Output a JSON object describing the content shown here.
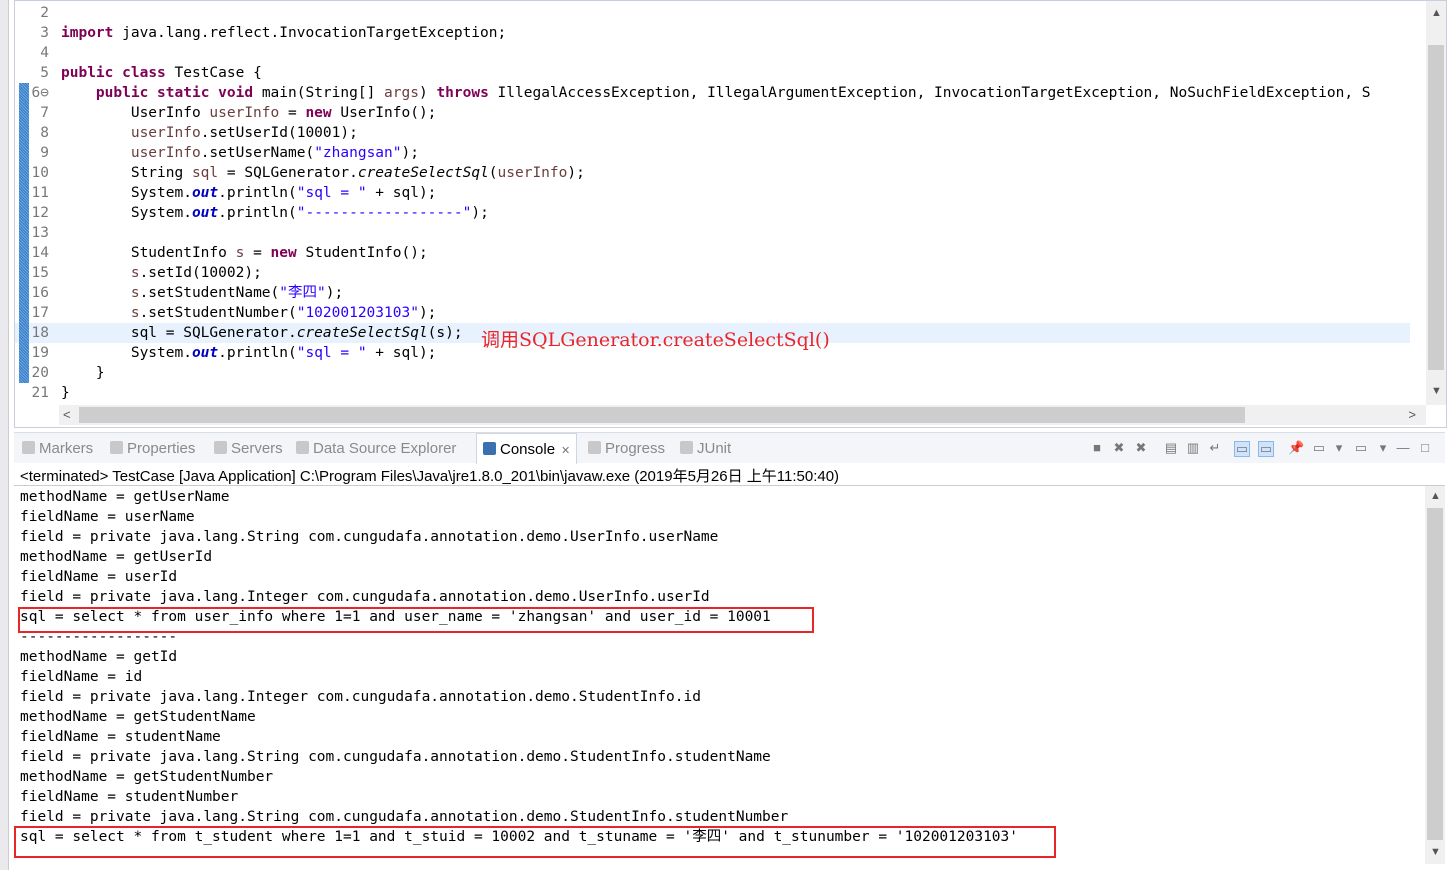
{
  "editor": {
    "lines": [
      {
        "n": "2",
        "t": []
      },
      {
        "n": "3",
        "t": [
          [
            "import",
            "k"
          ],
          [
            " java.lang.reflect.InvocationTargetException;",
            ""
          ]
        ]
      },
      {
        "n": "4",
        "t": []
      },
      {
        "n": "5",
        "t": [
          [
            "public",
            "k"
          ],
          [
            " ",
            ""
          ],
          [
            "class",
            "k"
          ],
          [
            " TestCase {",
            ""
          ]
        ]
      },
      {
        "n": "6⊖",
        "t": [
          [
            "    ",
            ""
          ],
          [
            "public",
            "k"
          ],
          [
            " ",
            ""
          ],
          [
            "static",
            "k"
          ],
          [
            " ",
            ""
          ],
          [
            "void",
            "k"
          ],
          [
            " main(String[] ",
            ""
          ],
          [
            "args",
            "p"
          ],
          [
            ") ",
            ""
          ],
          [
            "throws",
            "k"
          ],
          [
            " IllegalAccessException, IllegalArgumentException, InvocationTargetException, NoSuchFieldException, S",
            ""
          ]
        ]
      },
      {
        "n": "7",
        "t": [
          [
            "        UserInfo ",
            ""
          ],
          [
            "userInfo",
            "v"
          ],
          [
            " = ",
            ""
          ],
          [
            "new",
            "k"
          ],
          [
            " UserInfo();",
            ""
          ]
        ]
      },
      {
        "n": "8",
        "t": [
          [
            "        ",
            ""
          ],
          [
            "userInfo",
            "v"
          ],
          [
            ".setUserId(10001);",
            ""
          ]
        ]
      },
      {
        "n": "9",
        "t": [
          [
            "        ",
            ""
          ],
          [
            "userInfo",
            "v"
          ],
          [
            ".setUserName(",
            ""
          ],
          [
            "\"zhangsan\"",
            "s"
          ],
          [
            ");",
            ""
          ]
        ]
      },
      {
        "n": "10",
        "t": [
          [
            "        String ",
            ""
          ],
          [
            "sql",
            "v"
          ],
          [
            " = SQLGenerator.",
            ""
          ],
          [
            "createSelectSql",
            "i"
          ],
          [
            "(",
            ""
          ],
          [
            "userInfo",
            "v"
          ],
          [
            ");",
            ""
          ]
        ]
      },
      {
        "n": "11",
        "t": [
          [
            "        System.",
            ""
          ],
          [
            "out",
            "sf"
          ],
          [
            ".println(",
            ""
          ],
          [
            "\"sql = \"",
            "s"
          ],
          [
            " + sql);",
            ""
          ]
        ]
      },
      {
        "n": "12",
        "t": [
          [
            "        System.",
            ""
          ],
          [
            "out",
            "sf"
          ],
          [
            ".println(",
            ""
          ],
          [
            "\"------------------\"",
            "s"
          ],
          [
            ");",
            ""
          ]
        ]
      },
      {
        "n": "13",
        "t": []
      },
      {
        "n": "14",
        "t": [
          [
            "        StudentInfo ",
            ""
          ],
          [
            "s",
            "v"
          ],
          [
            " = ",
            ""
          ],
          [
            "new",
            "k"
          ],
          [
            " StudentInfo();",
            ""
          ]
        ]
      },
      {
        "n": "15",
        "t": [
          [
            "        ",
            ""
          ],
          [
            "s",
            "v"
          ],
          [
            ".setId(10002);",
            ""
          ]
        ]
      },
      {
        "n": "16",
        "t": [
          [
            "        ",
            ""
          ],
          [
            "s",
            "v"
          ],
          [
            ".setStudentName(",
            ""
          ],
          [
            "\"李四\"",
            "s"
          ],
          [
            ");",
            ""
          ]
        ]
      },
      {
        "n": "17",
        "t": [
          [
            "        ",
            ""
          ],
          [
            "s",
            "v"
          ],
          [
            ".setStudentNumber(",
            ""
          ],
          [
            "\"102001203103\"",
            "s"
          ],
          [
            ");",
            ""
          ]
        ]
      },
      {
        "n": "18",
        "t": [
          [
            "        sql = SQLGenerator.",
            ""
          ],
          [
            "createSelectSql",
            "i"
          ],
          [
            "(s);",
            ""
          ]
        ]
      },
      {
        "n": "19",
        "t": [
          [
            "        System.",
            ""
          ],
          [
            "out",
            "sf"
          ],
          [
            ".println(",
            ""
          ],
          [
            "\"sql = \"",
            "s"
          ],
          [
            " + sql);",
            ""
          ]
        ]
      },
      {
        "n": "20",
        "t": [
          [
            "    }",
            ""
          ]
        ]
      },
      {
        "n": "21",
        "t": [
          [
            "}",
            ""
          ]
        ]
      }
    ],
    "annotation": "调用SQLGenerator.createSelectSql()"
  },
  "tabs": [
    {
      "label": "Markers",
      "icon": "markers-icon"
    },
    {
      "label": "Properties",
      "icon": "properties-icon"
    },
    {
      "label": "Servers",
      "icon": "servers-icon"
    },
    {
      "label": "Data Source Explorer",
      "icon": "data-source-icon"
    },
    {
      "label": "Console",
      "icon": "console-icon",
      "active": true
    },
    {
      "label": "Progress",
      "icon": "progress-icon"
    },
    {
      "label": "JUnit",
      "icon": "junit-icon"
    }
  ],
  "console": {
    "status": "<terminated> TestCase [Java Application] C:\\Program Files\\Java\\jre1.8.0_201\\bin\\javaw.exe (2019年5月26日 上午11:50:40)",
    "lines": [
      "methodName = getUserName",
      "fieldName = userName",
      "field = private java.lang.String com.cungudafa.annotation.demo.UserInfo.userName",
      "methodName = getUserId",
      "fieldName = userId",
      "field = private java.lang.Integer com.cungudafa.annotation.demo.UserInfo.userId",
      "sql = select * from user_info where 1=1 and user_name = 'zhangsan' and user_id = 10001",
      "------------------",
      "methodName = getId",
      "fieldName = id",
      "field = private java.lang.Integer com.cungudafa.annotation.demo.StudentInfo.id",
      "methodName = getStudentName",
      "fieldName = studentName",
      "field = private java.lang.String com.cungudafa.annotation.demo.StudentInfo.studentName",
      "methodName = getStudentNumber",
      "fieldName = studentNumber",
      "field = private java.lang.String com.cungudafa.annotation.demo.StudentInfo.studentNumber",
      "sql = select * from t_student where 1=1 and t_stuid = 10002 and t_stuname = '李四' and t_stunumber = '102001203103'"
    ]
  },
  "colors": {
    "highlight": "#e8262a",
    "keyword": "#7f0055",
    "string": "#2a00ff"
  }
}
